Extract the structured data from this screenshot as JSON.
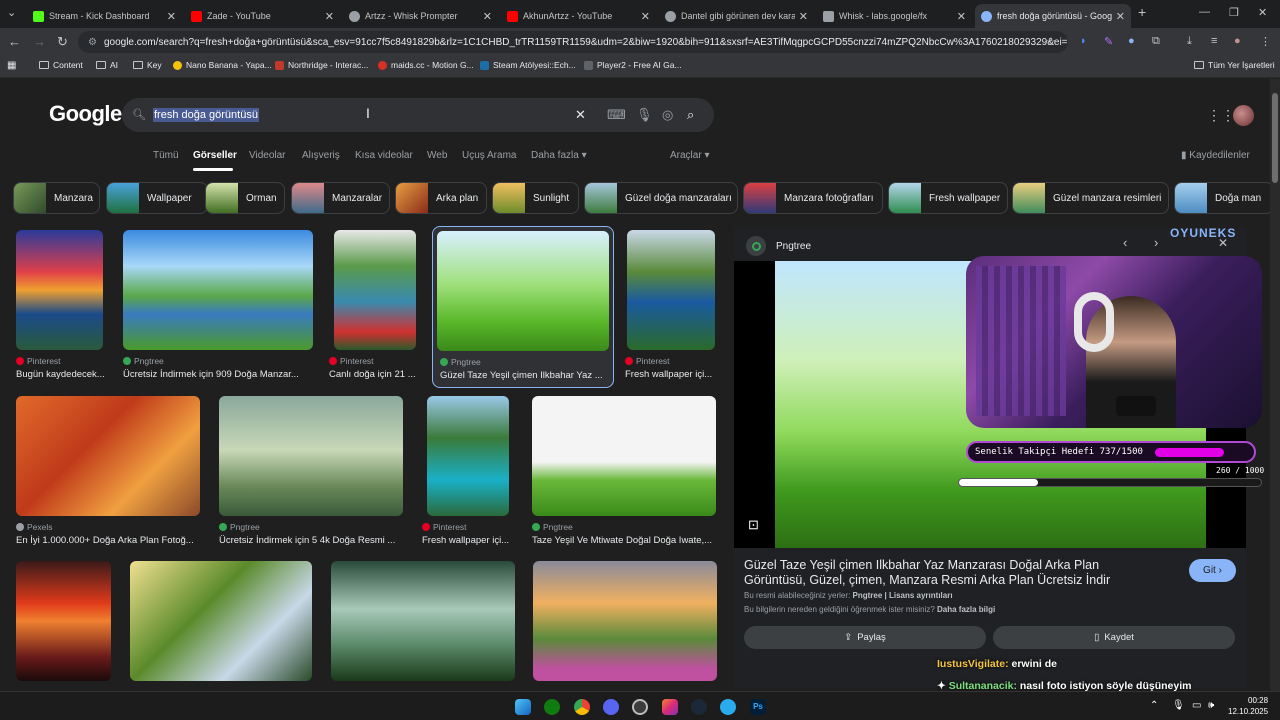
{
  "tabs": [
    {
      "title": "Stream - Kick Dashboard",
      "favicon_color": "#53fc18",
      "active": false
    },
    {
      "title": "Zade - YouTube",
      "favicon_color": "#ff0000",
      "active": false
    },
    {
      "title": "Artzz - Whisk Prompter",
      "favicon_color": "#9aa0a6",
      "active": false
    },
    {
      "title": "AkhunArtzz - YouTube",
      "favicon_color": "#ff0000",
      "active": false
    },
    {
      "title": "Dantel gibi görünen dev kara d",
      "favicon_color": "#9aa0a6",
      "active": false
    },
    {
      "title": "Whisk - labs.google/fx",
      "favicon_color": "#9aa0a6",
      "active": false
    },
    {
      "title": "fresh doğa görüntüsü - Google",
      "favicon_color": "#8ab4f8",
      "active": true
    }
  ],
  "address_bar": {
    "url": "google.com/search?q=fresh+doğa+görüntüsü&sca_esv=91cc7f5c8491829b&rlz=1C1CHBD_trTR1159TR1159&udm=2&biw=1920&bih=911&sxsrf=AE3TifMqgpcGCPD55cnzzi74mZPQ2NbcCw%3A1760218029329&ei=rcvqaKj..."
  },
  "bookmarks": {
    "items": [
      "Content",
      "AI",
      "Key",
      "Nano Banana - Yapa...",
      "Northridge - Interac...",
      "maids.cc - Motion G...",
      "Steam Atölyesi::Ech...",
      "Player2 - Free AI Ga..."
    ],
    "all_label": "Tüm Yer İşaretleri"
  },
  "google": {
    "logo": "Google",
    "query": "fresh doğa görüntüsü",
    "tabs": [
      "Tümü",
      "Görseller",
      "Videolar",
      "Alışveriş",
      "Kısa videolar",
      "Web",
      "Uçuş Arama",
      "Daha fazla ▾"
    ],
    "tools": "Araçlar ▾",
    "saved": "Kaydedilenler"
  },
  "chips": [
    "Manzara",
    "Wallpaper",
    "Orman",
    "Manzaralar",
    "Arka plan",
    "Sunlight",
    "Güzel doğa manzaraları",
    "Manzara fotoğrafları",
    "Fresh wallpaper",
    "Güzel manzara resimleri",
    "Doğa man"
  ],
  "results": [
    {
      "source": "Pinterest",
      "caption": "Bugün kaydedecek...",
      "src_color": "#e60023"
    },
    {
      "source": "Pngtree",
      "caption": "Ücretsiz İndirmek için 909 Doğa Manzar...",
      "src_color": "#34a853"
    },
    {
      "source": "Pinterest",
      "caption": "Canlı doğa için 21 ...",
      "src_color": "#e60023"
    },
    {
      "source": "Pngtree",
      "caption": "Güzel Taze Yeşil çimen Ilkbahar Yaz ...",
      "src_color": "#34a853"
    },
    {
      "source": "Pinterest",
      "caption": "Fresh wallpaper içi...",
      "src_color": "#e60023"
    },
    {
      "source": "Pexels",
      "caption": "En İyi 1.000.000+ Doğa Arka Plan Fotoğ...",
      "src_color": "#9aa0a6"
    },
    {
      "source": "Pngtree",
      "caption": "Ücretsiz İndirmek için 5 4k Doğa Resmi ...",
      "src_color": "#34a853"
    },
    {
      "source": "Pinterest",
      "caption": "Fresh wallpaper içi...",
      "src_color": "#e60023"
    },
    {
      "source": "Pngtree",
      "caption": "Taze Yeşil Ve Mtiwate Doğal Doğa Iwate,...",
      "src_color": "#34a853"
    }
  ],
  "panel": {
    "site": "Pngtree",
    "title": "Güzel Taze Yeşil çimen Ilkbahar Yaz Manzarası Doğal Arka Plan Görüntüsü, Güzel, çimen, Manzara Resmi Arka Plan Ücretsiz İndir",
    "go": "Git ›",
    "license_prefix": "Bu resmi alabileceğiniz yerler:",
    "license_site": "Pngtree | Lisans ayrıntıları",
    "info_prefix": "Bu bilgilerin nereden geldiğini öğrenmek ister misiniz?",
    "info_link": "Daha fazla bilgi",
    "share": "Paylaş",
    "save": "Kaydet"
  },
  "overlay": {
    "brand": "OYUNEKS",
    "goal": "Senelik Takipçi Hedefi 737/1500",
    "goal_progress": 0.49,
    "bits": "260 / 1000",
    "bits_progress": 0.26,
    "chat": [
      {
        "user": "IustusVigilate:",
        "message": "erwini de"
      },
      {
        "user": "Sultananacik:",
        "message": "nasıl foto istiyon söyle düşüneyim"
      }
    ]
  },
  "taskbar": {
    "time": "00:28",
    "date": "12.10.2025"
  },
  "colors": {
    "accent": "#8ab4f8",
    "overlay_purple": "#b04ad6",
    "goal_fill": "#e200e6"
  }
}
